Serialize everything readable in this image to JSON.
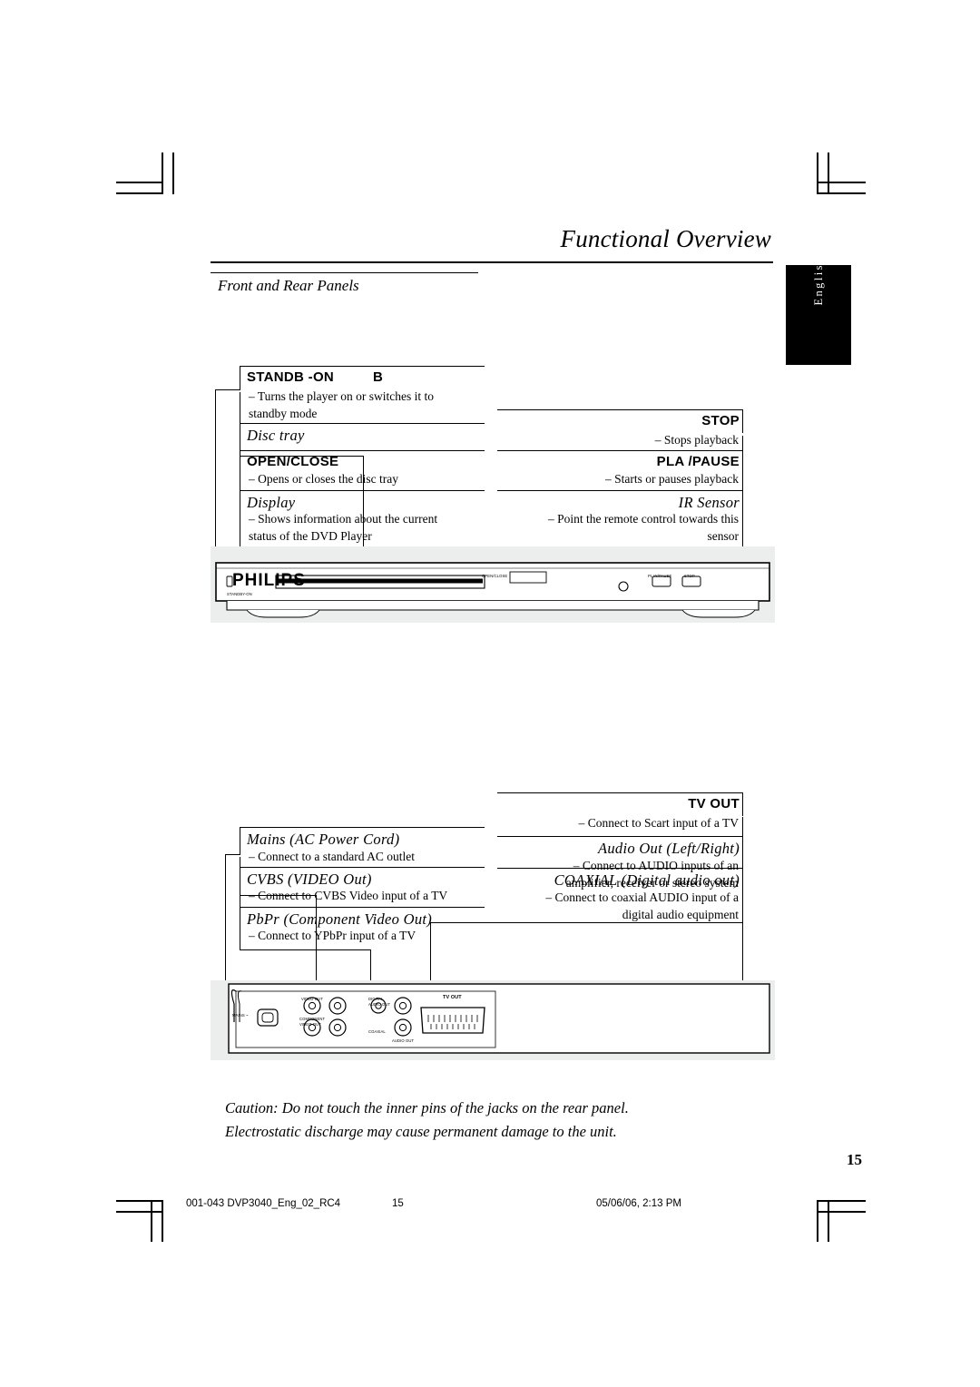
{
  "page": {
    "title": "Functional Overview",
    "subtitle": "Front and Rear Panels",
    "side_tab": "English",
    "page_number": "15"
  },
  "front_panel": {
    "callouts": [
      {
        "head": "STANDB -ON",
        "head_extra": "B",
        "body": "–   Turns the player on or switches it to\n     standby mode"
      },
      {
        "head": "Disc tray",
        "body": ""
      },
      {
        "head": "OPEN/CLOSE",
        "body": "–   Opens or closes the disc tray"
      },
      {
        "head": "Display",
        "body": "–   Shows information about the current\n     status of the DVD Player"
      },
      {
        "head": "STOP",
        "body": "– Stops playback"
      },
      {
        "head": "PLA /PAUSE",
        "body": "– Starts or pauses playback"
      },
      {
        "head": "IR Sensor",
        "body": "– Point the remote control towards this\nsensor"
      }
    ],
    "brand": "PHILIPS",
    "labels": {
      "standby": "STANDBY-ON",
      "open_close": "OPEN/CLOSE",
      "play_pause": "PLAY/PAUSE",
      "stop": "STOP"
    }
  },
  "rear_panel": {
    "callouts": [
      {
        "head": "Mains (AC Power Cord)",
        "body": "–   Connect to a standard AC outlet"
      },
      {
        "head": "CVBS (VIDEO Out)",
        "body": "–   Connect to CVBS Video input of a TV"
      },
      {
        "head": "PbPr (Component Video Out)",
        "body": "–   Connect to YPbPr input of a TV"
      },
      {
        "head": "TV OUT",
        "body": "– Connect to Scart input of a TV"
      },
      {
        "head": "Audio Out (Left/Right)",
        "body": "–  Connect to AUDIO inputs of an\namplifier, receiver or stereo system"
      },
      {
        "head": "COAXIAL (Digital audio out)",
        "body": "–  Connect to coaxial AUDIO input of a\ndigital audio equipment"
      }
    ],
    "jack_labels": {
      "mains": "MAINS ~",
      "video_out": "VIDEO OUT",
      "component": "COMPONENT",
      "component2": "VIDEO OUT",
      "digital": "DIGITAL",
      "audio_out_d": "AUDIO OUT",
      "coaxial": "COAXIAL",
      "audio_out": "AUDIO OUT",
      "tv_out": "TV OUT"
    }
  },
  "caution": {
    "line1": "Caution: Do not touch the inner pins of the jacks on the rear panel.",
    "line2": "Electrostatic discharge may cause permanent damage to the unit."
  },
  "footer": {
    "file": "001-043 DVP3040_Eng_02_RC4",
    "page": "15",
    "date": "05/06/06, 2:13 PM"
  }
}
